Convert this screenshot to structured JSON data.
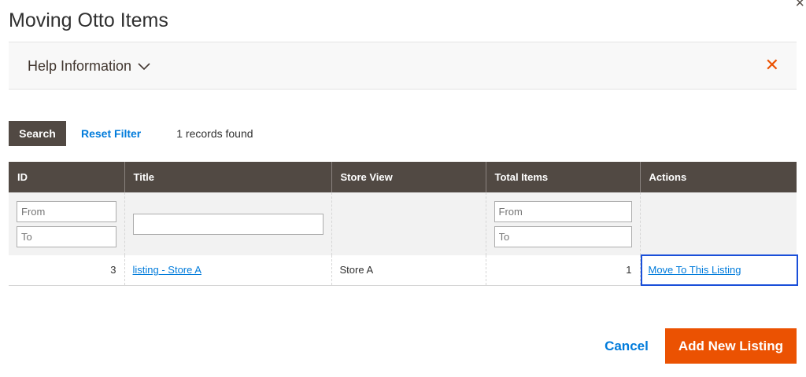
{
  "modal": {
    "title": "Moving Otto Items",
    "close_glyph": "×"
  },
  "help": {
    "title": "Help Information",
    "close_glyph": "✕"
  },
  "toolbar": {
    "search_label": "Search",
    "reset_label": "Reset Filter",
    "records_text": "1 records found"
  },
  "grid": {
    "columns": [
      "ID",
      "Title",
      "Store View",
      "Total Items",
      "Actions"
    ],
    "filters": {
      "id_from_placeholder": "From",
      "id_to_placeholder": "To",
      "title_value": "",
      "total_from_placeholder": "From",
      "total_to_placeholder": "To"
    },
    "rows": [
      {
        "id": "3",
        "title": "listing - Store A",
        "store_view": "Store A",
        "total_items": "1",
        "action": "Move To This Listing"
      }
    ]
  },
  "footer": {
    "cancel_label": "Cancel",
    "add_label": "Add New Listing"
  },
  "colors": {
    "header_bg": "#514943",
    "accent": "#eb5202",
    "link": "#007bdb"
  }
}
